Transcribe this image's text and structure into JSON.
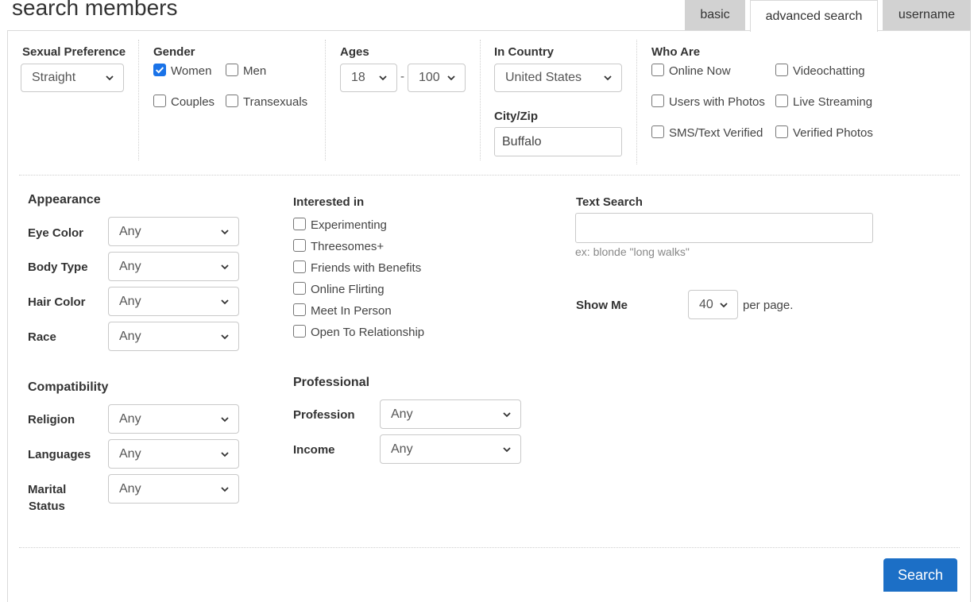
{
  "header": {
    "title": "search members",
    "tabs": [
      {
        "label": "basic",
        "active": false
      },
      {
        "label": "advanced search",
        "active": true
      },
      {
        "label": "username",
        "active": false
      }
    ]
  },
  "top": {
    "sexual_preference": {
      "label": "Sexual Preference",
      "value": "Straight"
    },
    "gender": {
      "label": "Gender",
      "options": [
        {
          "label": "Women",
          "checked": true
        },
        {
          "label": "Men",
          "checked": false
        },
        {
          "label": "Couples",
          "checked": false
        },
        {
          "label": "Transexuals",
          "checked": false
        }
      ]
    },
    "ages": {
      "label": "Ages",
      "min": "18",
      "separator": "-",
      "max": "100"
    },
    "country": {
      "label": "In Country",
      "value": "United States"
    },
    "city": {
      "label": "City/Zip",
      "value": "Buffalo"
    },
    "who_are": {
      "label": "Who Are",
      "options": [
        {
          "label": "Online Now",
          "checked": false
        },
        {
          "label": "Videochatting",
          "checked": false
        },
        {
          "label": "Users with Photos",
          "checked": false
        },
        {
          "label": "Live Streaming",
          "checked": false
        },
        {
          "label": "SMS/Text Verified",
          "checked": false
        },
        {
          "label": "Verified Photos",
          "checked": false
        }
      ]
    }
  },
  "appearance": {
    "heading": "Appearance",
    "fields": [
      {
        "label": "Eye Color",
        "value": "Any"
      },
      {
        "label": "Body Type",
        "value": "Any"
      },
      {
        "label": "Hair Color",
        "value": "Any"
      },
      {
        "label": "Race",
        "value": "Any"
      }
    ]
  },
  "compatibility": {
    "heading": "Compatibility",
    "fields": [
      {
        "label": "Religion",
        "value": "Any"
      },
      {
        "label": "Languages",
        "value": "Any"
      },
      {
        "label_line1": "Marital",
        "label_line2": "Status",
        "value": "Any"
      }
    ]
  },
  "interested_in": {
    "heading": "Interested in",
    "options": [
      {
        "label": "Experimenting",
        "checked": false
      },
      {
        "label": "Threesomes+",
        "checked": false
      },
      {
        "label": "Friends with Benefits",
        "checked": false
      },
      {
        "label": "Online Flirting",
        "checked": false
      },
      {
        "label": "Meet In Person",
        "checked": false
      },
      {
        "label": "Open To Relationship",
        "checked": false
      }
    ]
  },
  "professional": {
    "heading": "Professional",
    "fields": [
      {
        "label": "Profession",
        "value": "Any"
      },
      {
        "label": "Income",
        "value": "Any"
      }
    ]
  },
  "text_search": {
    "heading": "Text Search",
    "value": "",
    "hint": "ex: blonde \"long walks\""
  },
  "show_me": {
    "label": "Show Me",
    "value": "40",
    "suffix": "per page."
  },
  "search_button": {
    "label": "Search"
  },
  "colors": {
    "accent": "#1c6fc6",
    "checkbox_checked": "#1a73e8",
    "tab_inactive": "#d2d2d2"
  }
}
